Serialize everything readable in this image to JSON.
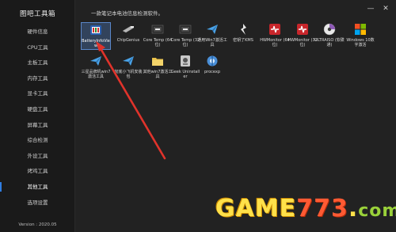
{
  "sidebar": {
    "title": "图吧工具箱",
    "items": [
      {
        "label": "硬件信息"
      },
      {
        "label": "CPU工具"
      },
      {
        "label": "主板工具"
      },
      {
        "label": "内存工具"
      },
      {
        "label": "显卡工具"
      },
      {
        "label": "硬盘工具"
      },
      {
        "label": "屏幕工具"
      },
      {
        "label": "综合检测"
      },
      {
        "label": "外设工具"
      },
      {
        "label": "烤鸡工具"
      },
      {
        "label": "其他工具"
      },
      {
        "label": "选项设置"
      }
    ],
    "active_index": 10,
    "version": "Version : 2020.05"
  },
  "header": {
    "description": "一款笔记本电池信息检测软件。",
    "minimize_label": "—",
    "close_label": "✕"
  },
  "apps_row1": [
    {
      "label": "BatteryInfoView",
      "icon": "battery-icon",
      "selected": true
    },
    {
      "label": "ChipGenius",
      "icon": "usb-chip-icon"
    },
    {
      "label": "Core Temp (64位)",
      "icon": "thermometer-icon"
    },
    {
      "label": "Core Temp (32位)",
      "icon": "thermometer-icon"
    },
    {
      "label": "通用Win7激活工具",
      "icon": "paper-plane-icon"
    },
    {
      "label": "密钥了KMS",
      "icon": "kms-icon"
    },
    {
      "label": "HWMonitor (64位)",
      "icon": "hwmonitor-icon"
    },
    {
      "label": "HWMonitor (32位)",
      "icon": "hwmonitor-icon"
    },
    {
      "label": "ULTRAISO (软碟通)",
      "icon": "disc-icon"
    },
    {
      "label": "Windows 10数字激活",
      "icon": "windows-icon"
    }
  ],
  "apps_row2": [
    {
      "label": "三星品牌机win7激活工具",
      "icon": "paper-plane-icon"
    },
    {
      "label": "彻底小飞机安装包",
      "icon": "paper-plane-icon"
    },
    {
      "label": "其他win7激活工具",
      "icon": "folder-icon"
    },
    {
      "label": "Geek Uninstaller",
      "icon": "geek-icon"
    },
    {
      "label": "procexp",
      "icon": "procexp-icon"
    }
  ],
  "watermark": {
    "game": "GAME",
    "num": "773",
    "dot": ".",
    "com": "com"
  },
  "colors": {
    "accent": "#2f7de1",
    "arrow": "#e0332b"
  }
}
